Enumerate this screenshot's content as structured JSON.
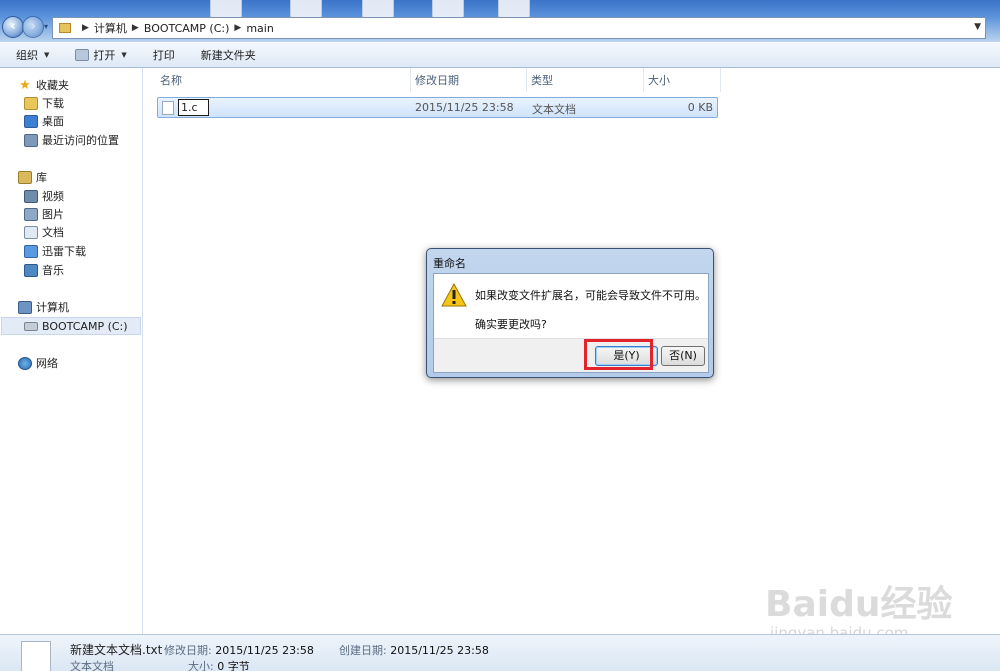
{
  "address": {
    "path": [
      "计算机",
      "BOOTCAMP (C:)",
      "main"
    ]
  },
  "toolbar": {
    "organize": "组织",
    "open": "打开",
    "print": "打印",
    "new_folder": "新建文件夹"
  },
  "sidebar": {
    "favorites": "收藏夹",
    "downloads": "下载",
    "desktop": "桌面",
    "recent": "最近访问的位置",
    "libraries": "库",
    "videos": "视频",
    "pictures": "图片",
    "documents": "文档",
    "thunder": "迅雷下载",
    "music": "音乐",
    "computer": "计算机",
    "drive": "BOOTCAMP (C:)",
    "network": "网络"
  },
  "columns": {
    "name": "名称",
    "modified": "修改日期",
    "type": "类型",
    "size": "大小"
  },
  "file": {
    "name": "1.c",
    "modified": "2015/11/25 23:58",
    "type": "文本文档",
    "size": "0 KB"
  },
  "dialog": {
    "title": "重命名",
    "message": "如果改变文件扩展名，可能会导致文件不可用。",
    "question": "确实要更改吗?",
    "yes": "是(Y)",
    "no": "否(N)"
  },
  "details": {
    "filename": "新建文本文档.txt",
    "filetype": "文本文档",
    "modified_key": "修改日期:",
    "modified_val": "2015/11/25 23:58",
    "created_key": "创建日期:",
    "created_val": "2015/11/25 23:58",
    "size_key": "大小:",
    "size_val": "0 字节"
  },
  "watermark": {
    "brand": "Baidu经验",
    "url": "jingyan.baidu.com"
  },
  "colors": {
    "highlight": "#e3232b"
  }
}
